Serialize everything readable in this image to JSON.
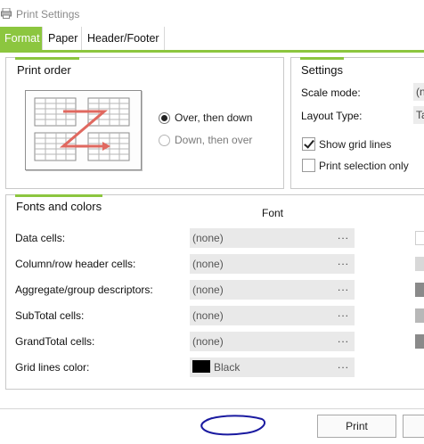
{
  "window": {
    "title": "Print Settings",
    "icon": "printer-icon"
  },
  "tabs": [
    {
      "label": "Format",
      "active": true
    },
    {
      "label": "Paper",
      "active": false
    },
    {
      "label": "Header/Footer",
      "active": false
    }
  ],
  "print_order": {
    "title": "Print order",
    "options": [
      {
        "label": "Over, then down",
        "selected": true
      },
      {
        "label": "Down, then over",
        "selected": false
      }
    ]
  },
  "settings": {
    "title": "Settings",
    "scale_mode_label": "Scale mode:",
    "scale_mode_value": "(n",
    "layout_type_label": "Layout Type:",
    "layout_type_value": "Ta",
    "show_grid_lines_label": "Show grid lines",
    "show_grid_lines_checked": true,
    "print_selection_only_label": "Print selection only",
    "print_selection_only_checked": false
  },
  "fonts_colors": {
    "title": "Fonts and colors",
    "font_column_header": "Font",
    "rows": [
      {
        "label": "Data cells:",
        "font": "(none)",
        "dots": "...",
        "swatch": "#ffffff"
      },
      {
        "label": "Column/row header cells:",
        "font": "(none)",
        "dots": "...",
        "swatch": "#d8d8d8"
      },
      {
        "label": "Aggregate/group descriptors:",
        "font": "(none)",
        "dots": "...",
        "swatch": "#8a8a8a"
      },
      {
        "label": "SubTotal cells:",
        "font": "(none)",
        "dots": "...",
        "swatch": "#b8b8b8"
      },
      {
        "label": "GrandTotal cells:",
        "font": "(none)",
        "dots": "...",
        "swatch": "#8a8a8a"
      },
      {
        "label": "Grid lines color:",
        "font": "Black",
        "dots": "...",
        "swatch": "#c8c8c8",
        "color": "#000000"
      }
    ]
  },
  "buttons": {
    "print_label": "Print",
    "next_label": ""
  },
  "colors": {
    "accent": "#8cc63f",
    "scribble": "#1a1aa0"
  }
}
